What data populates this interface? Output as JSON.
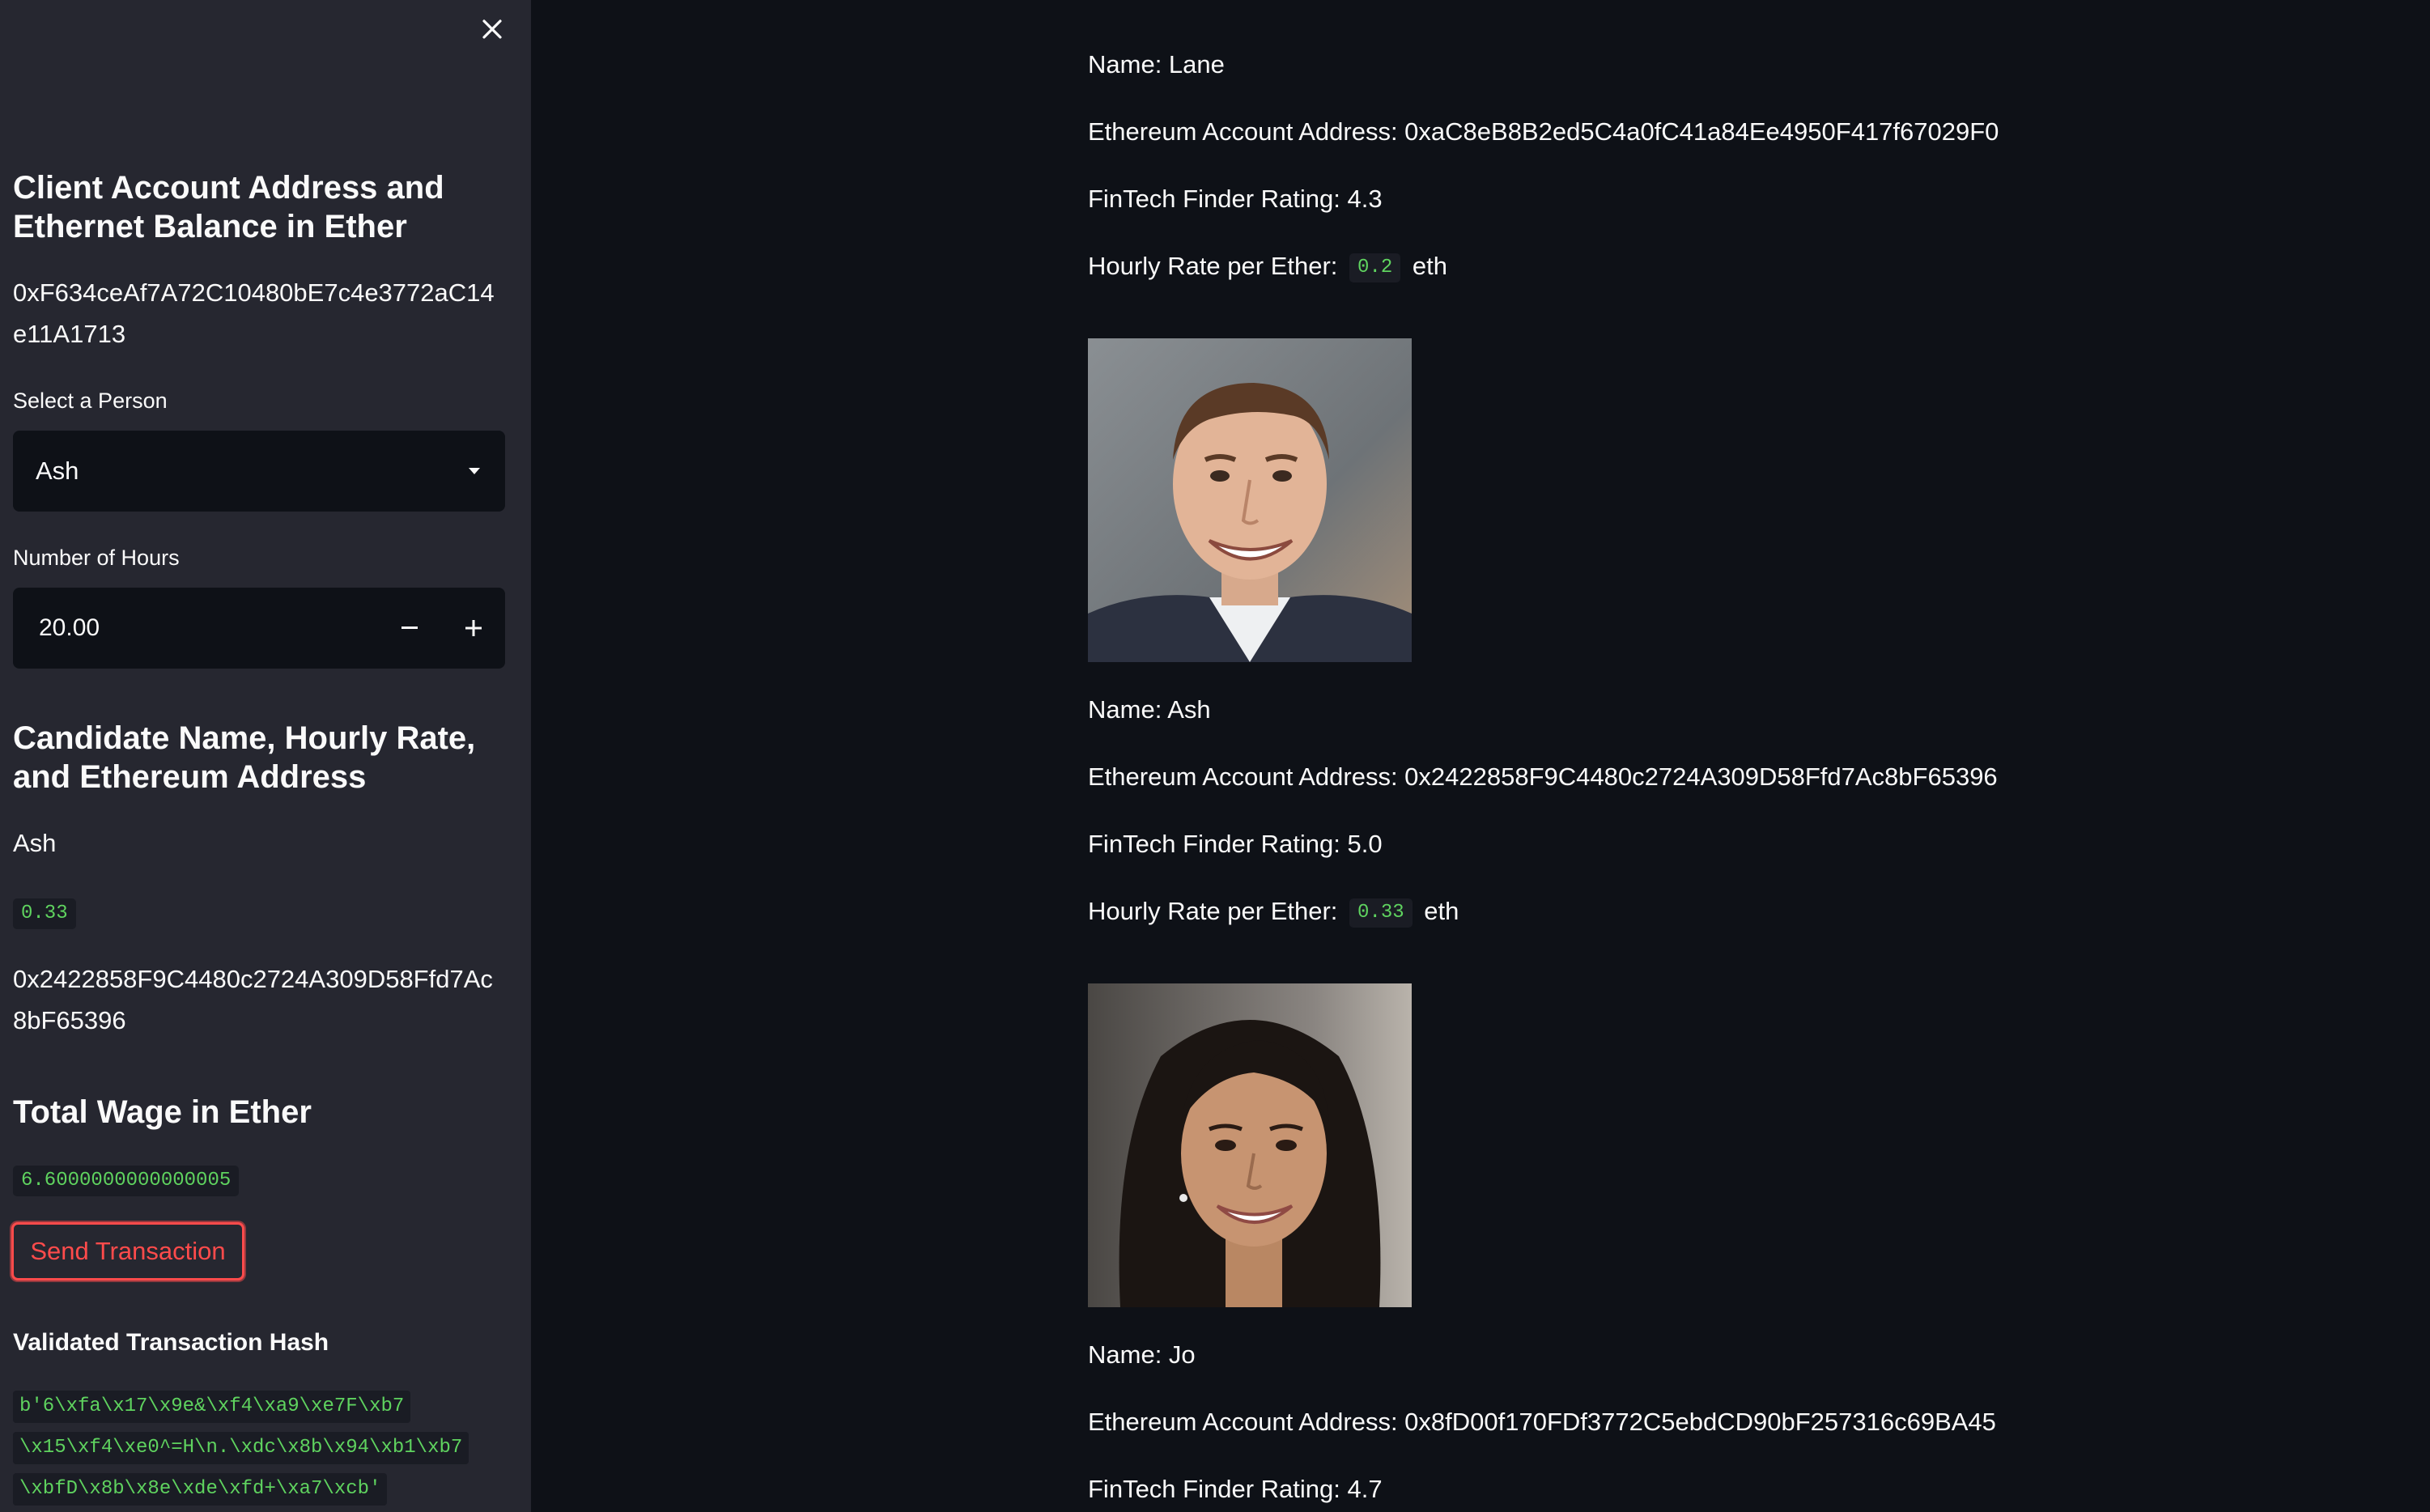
{
  "sidebar": {
    "close_icon": "close-icon",
    "account_heading": "Client Account Address and Ethernet Balance in Ether",
    "account_address": "0xF634ceAf7A72C10480bE7c4e3772aC14e11A1713",
    "select_label": "Select a Person",
    "selected_person": "Ash",
    "hours_label": "Number of Hours",
    "hours_value": "20.00",
    "candidate_heading": "Candidate Name, Hourly Rate, and Ethereum Address",
    "candidate_name": "Ash",
    "candidate_rate": "0.33",
    "candidate_address": "0x2422858F9C4480c2724A309D58Ffd7Ac8bF65396",
    "wage_heading": "Total Wage in Ether",
    "wage_value": "6.6000000000000005",
    "send_button": "Send Transaction",
    "hash_heading": "Validated Transaction Hash",
    "hash_lines": [
      "b'6\\xfa\\x17\\x9e&\\xf4\\xa9\\xe7F\\xb7",
      "\\x15\\xf4\\xe0^=H\\n.\\xdc\\x8b\\x94\\xb1\\xb7",
      "\\xbfD\\x8b\\x8e\\xde\\xfd+\\xa7\\xcb'"
    ]
  },
  "main": {
    "candidates": [
      {
        "name_line": "Name: Lane",
        "address_line": "Ethereum Account Address: 0xaC8eB8B2ed5C4a0fC41a84Ee4950F417f67029F0",
        "rating_line": "FinTech Finder Rating: 4.3",
        "rate_prefix": "Hourly Rate per Ether:",
        "rate_value": "0.2",
        "rate_suffix": "eth"
      },
      {
        "name_line": "Name: Ash",
        "address_line": "Ethereum Account Address: 0x2422858F9C4480c2724A309D58Ffd7Ac8bF65396",
        "rating_line": "FinTech Finder Rating: 5.0",
        "rate_prefix": "Hourly Rate per Ether:",
        "rate_value": "0.33",
        "rate_suffix": "eth"
      },
      {
        "name_line": "Name: Jo",
        "address_line": "Ethereum Account Address: 0x8fD00f170FDf3772C5ebdCD90bF257316c69BA45",
        "rating_line": "FinTech Finder Rating: 4.7"
      }
    ]
  },
  "colors": {
    "sidebar_bg": "#262730",
    "main_bg": "#0e1117",
    "accent_red": "#ff4b4b",
    "code_green": "#5fd35f"
  }
}
